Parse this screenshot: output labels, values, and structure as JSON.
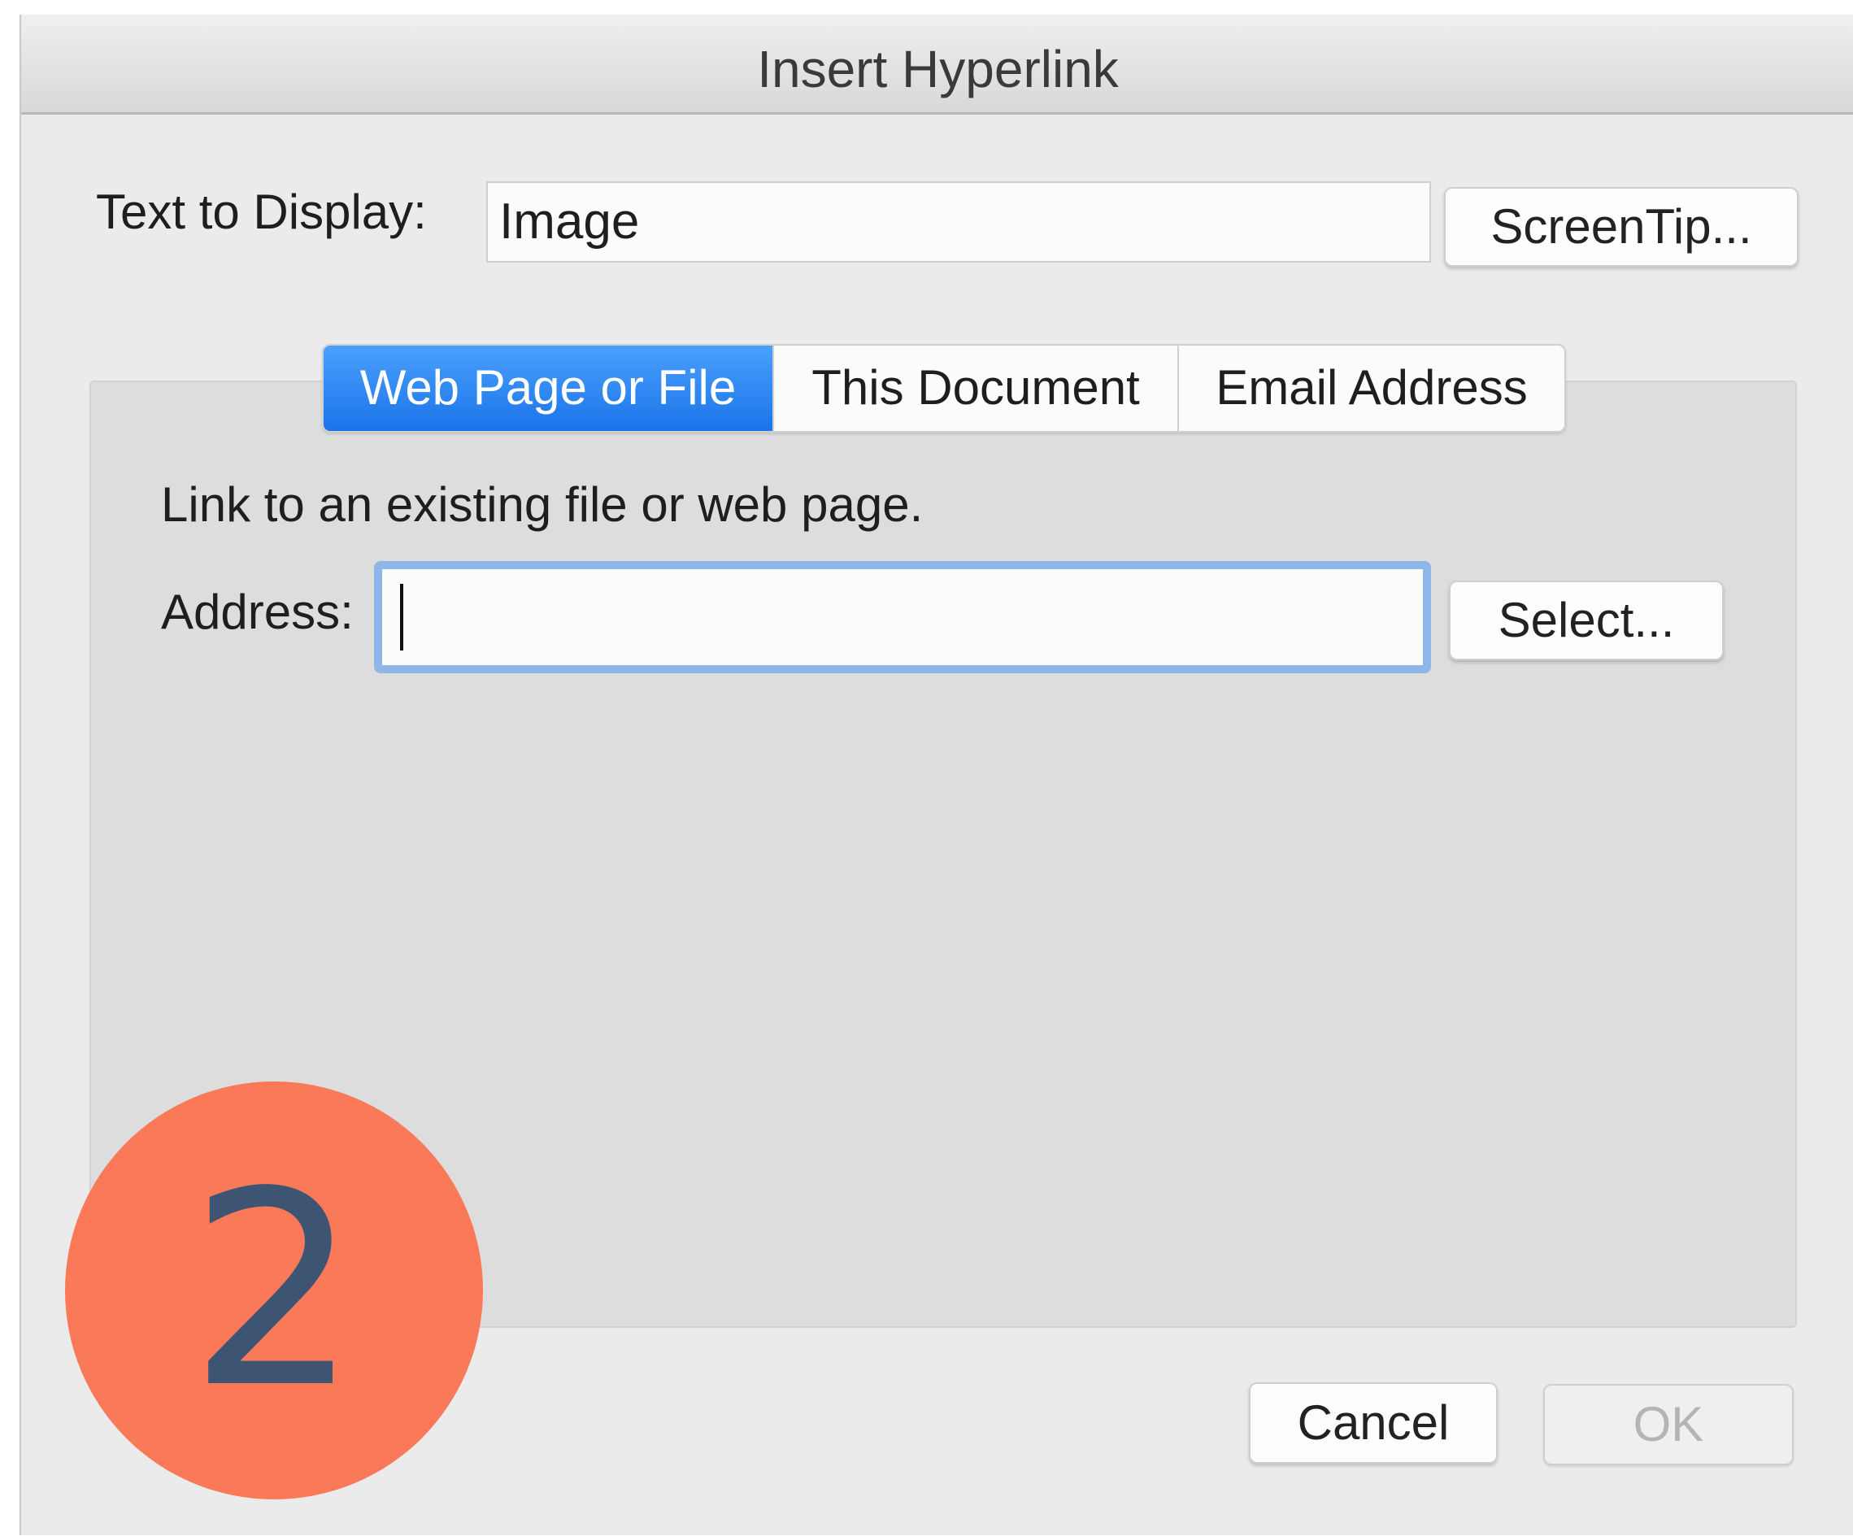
{
  "dialog": {
    "title": "Insert Hyperlink"
  },
  "display": {
    "label": "Text to Display:",
    "value": "Image",
    "screentip_button": "ScreenTip..."
  },
  "tabs": [
    {
      "label": "Web Page or File",
      "active": true
    },
    {
      "label": "This Document",
      "active": false
    },
    {
      "label": "Email Address",
      "active": false
    }
  ],
  "panel": {
    "description": "Link to an existing file or web page.",
    "address_label": "Address:",
    "address_value": "",
    "select_button": "Select..."
  },
  "footer": {
    "cancel_button": "Cancel",
    "ok_button": "OK",
    "ok_enabled": false
  },
  "badge": {
    "number": "2"
  },
  "colors": {
    "accent": "#1b74ea",
    "focus_ring": "#8fb6e8",
    "badge_bg": "#fa7958",
    "badge_text": "#3d5473"
  }
}
